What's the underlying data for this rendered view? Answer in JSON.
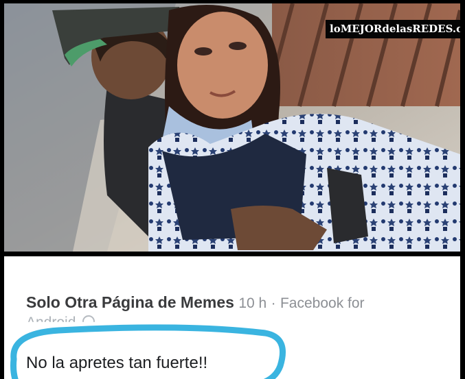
{
  "watermark": {
    "text": "loMEJORdelasREDES.com"
  },
  "post": {
    "page_name": "Solo Otra Página de Memes",
    "time": "10 h",
    "separator": "·",
    "source": "Facebook for",
    "source_continued": "Android",
    "text": "No la apretes tan fuerte!!"
  },
  "colors": {
    "highlight_ring": "#3ab4e0",
    "page_name": "#3a3b3d",
    "meta": "#8c8f94",
    "text": "#1c1e21"
  }
}
